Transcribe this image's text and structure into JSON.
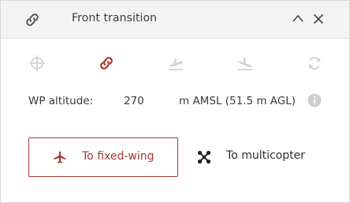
{
  "header": {
    "title": "Front transition",
    "icon": "link-icon",
    "collapse_icon": "chevron-up-icon",
    "close_icon": "close-icon"
  },
  "mode_icons": [
    "crosshair-icon",
    "link-icon",
    "takeoff-icon",
    "landing-icon",
    "refresh-icon"
  ],
  "altitude": {
    "label": "WP altitude:",
    "value": "270",
    "unit": "m AMSL (51.5 m AGL)"
  },
  "actions": {
    "fixed_wing_label": "To fixed-wing",
    "multicopter_label": "To multicopter"
  },
  "colors": {
    "accent": "#a63a33",
    "icon_gray": "#c8c8c8",
    "header_bg": "#f3f3f3"
  }
}
